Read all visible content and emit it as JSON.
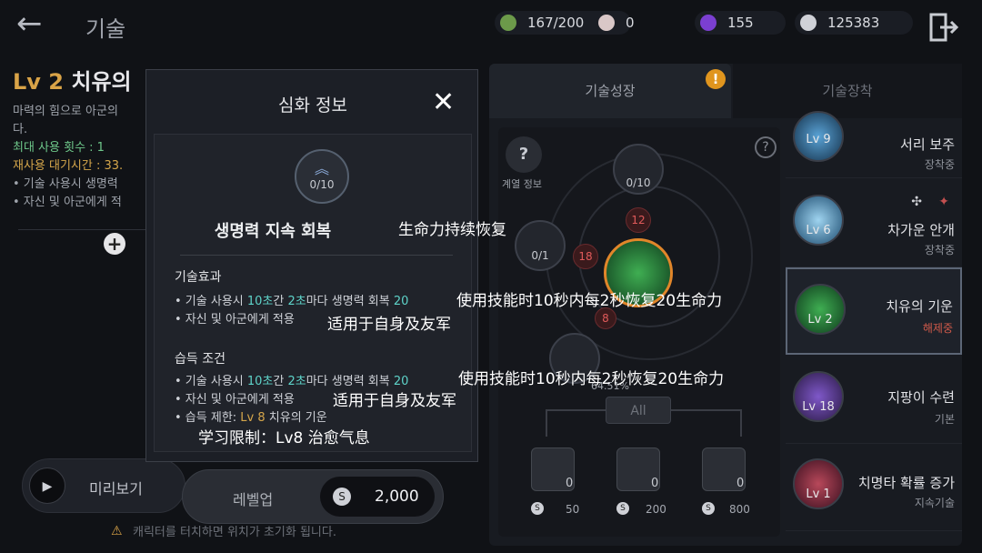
{
  "header": {
    "back_label": "←",
    "title": "기술",
    "resources": [
      {
        "name": "stamina",
        "value": "167/200",
        "color": "#6c9a4a"
      },
      {
        "name": "pearl",
        "value": "0",
        "color": "#d9c7c7"
      },
      {
        "name": "gem",
        "value": "155",
        "color": "#7b3fd1"
      },
      {
        "name": "silver",
        "value": "125383",
        "color": "#cfd1d7"
      }
    ]
  },
  "skill_detail": {
    "level": "Lv 2",
    "name": "치유의",
    "desc": "마력의 힘으로 아군의",
    "desc2": "다.",
    "max_uses": "최대 사용 횟수 : 1",
    "cooldown": "재사용 대기시간 : 33.",
    "effect1": "• 기술 사용시 생명력",
    "effect2": "• 자신 및 아군에게 적",
    "preview_label": "미리보기",
    "warning": "캐릭터를 터치하면 위치가 초기화 됩니다."
  },
  "tabs": {
    "growth": "기술성장",
    "equip": "기술장착"
  },
  "tree": {
    "lineage_info": "계열 정보",
    "top_node": "0/10",
    "left_node": "0/1",
    "badges": [
      "12",
      "18",
      "8"
    ],
    "pct": "64.51%",
    "all_label": "All",
    "books": [
      {
        "count": "0",
        "cost": "50"
      },
      {
        "count": "0",
        "cost": "200"
      },
      {
        "count": "0",
        "cost": "800"
      }
    ]
  },
  "skills": [
    {
      "level": "Lv 9",
      "name": "서리 보주",
      "status": "장착중"
    },
    {
      "level": "Lv 6",
      "name": "차가운 안개",
      "status": "장착중"
    },
    {
      "level": "Lv 2",
      "name": "치유의 기운",
      "status": "해제중"
    },
    {
      "level": "Lv 18",
      "name": "지팡이 수련",
      "status": "기본"
    },
    {
      "level": "Lv 1",
      "name": "치명타 확률 증가",
      "status": "지속기술"
    }
  ],
  "modal": {
    "title": "심화 정보",
    "close": "✕",
    "node_value": "0/10",
    "node_name": "생명력 지속 회복",
    "effect_header": "기술효과",
    "effect_line1_pre": "• 기술 사용시 ",
    "n10": "10초",
    "mid": "간 ",
    "n2": "2초",
    "effect_line1_post": "마다 생명력 회복 ",
    "n20": "20",
    "effect_line2": "• 자신 및 아군에게 적용",
    "req_header": "습득 조건",
    "req_line3_pre": "• 습득 제한: ",
    "req_lv": "Lv 8",
    "req_line3_post": " 치유의 기운",
    "levelup_label": "레벨업",
    "price": "2,000"
  },
  "overlay": {
    "name_cn": "生命力持续恢复",
    "effect1_cn": "使用技能时10秒内每2秒恢复20生命力",
    "effect2_cn": "适用于自身及友军",
    "effect3_cn": "使用技能时10秒内每2秒恢复20生命力",
    "effect4_cn": "适用于自身及友军",
    "req_cn": "学习限制：Lv8 治愈气息"
  }
}
